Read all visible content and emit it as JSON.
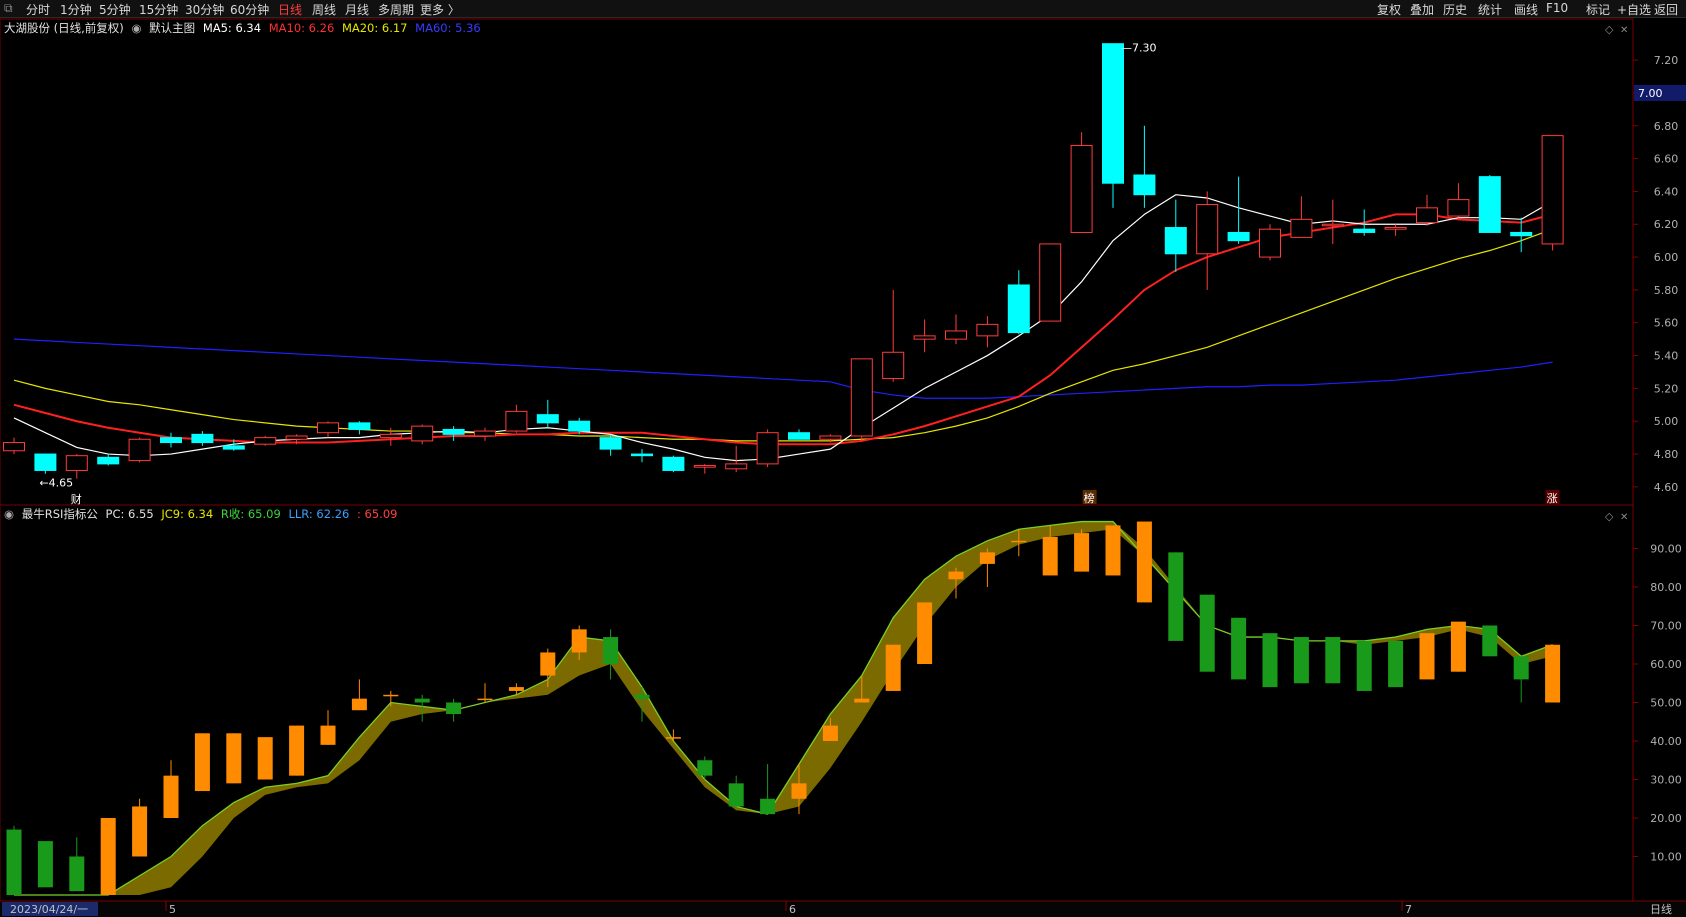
{
  "toolbar": {
    "left_items": [
      "分时",
      "1分钟",
      "5分钟",
      "15分钟",
      "30分钟",
      "60分钟",
      "日线",
      "周线",
      "月线",
      "多周期",
      "更多 〉"
    ],
    "active_index": 6,
    "right_items": [
      "复权",
      "叠加",
      "历史",
      "统计",
      "画线",
      "F10",
      "标记",
      "+自选",
      "返回"
    ]
  },
  "main_header": {
    "stock": "大湖股份 (日线,前复权)",
    "chart_name": "默认主图",
    "ma5": "MA5: 6.34",
    "ma10": "MA10: 6.26",
    "ma20": "MA20: 6.17",
    "ma60": "MA60: 5.36"
  },
  "sub_header": {
    "indicator": "最牛RSI指标公",
    "pc": "PC: 6.55",
    "jc9": "JC9: 6.34",
    "rsi": "R收: 65.09",
    "llr": "LLR: 62.26",
    "extra": ": 65.09"
  },
  "colors": {
    "up": "#ff3b3b",
    "down": "#00ffff",
    "ma5": "#ffffff",
    "ma10": "#ff2020",
    "ma20": "#e6e600",
    "ma60": "#2020ff",
    "rsi_up": "#ff8c00",
    "rsi_down": "#1a9a1a",
    "band": "#7a6a00"
  },
  "main_axis": {
    "min": 4.52,
    "max": 7.42,
    "ticks": [
      "7.20",
      "7.00",
      "6.80",
      "6.60",
      "6.40",
      "6.20",
      "6.00",
      "5.80",
      "5.60",
      "5.40",
      "5.20",
      "5.00",
      "4.80",
      "4.60"
    ],
    "current_price": "7.00"
  },
  "sub_axis": {
    "ticks": [
      "90.00",
      "80.00",
      "70.00",
      "60.00",
      "50.00",
      "40.00",
      "30.00",
      "20.00",
      "10.00"
    ]
  },
  "annotations": {
    "high_label": "7.30",
    "low_label": "4.65",
    "marker_cai": "财",
    "marker_bang": "榜",
    "marker_zhang": "涨"
  },
  "x_axis": {
    "labels": [
      "2023/04/24/一",
      "5",
      "6",
      "7"
    ],
    "period": "日线"
  },
  "chart_data": {
    "type": "candlestick",
    "ohlc": [
      [
        4.82,
        4.9,
        4.8,
        4.87
      ],
      [
        4.8,
        4.8,
        4.68,
        4.7
      ],
      [
        4.7,
        4.8,
        4.65,
        4.79
      ],
      [
        4.78,
        4.8,
        4.73,
        4.74
      ],
      [
        4.76,
        4.9,
        4.75,
        4.89
      ],
      [
        4.9,
        4.93,
        4.84,
        4.87
      ],
      [
        4.92,
        4.94,
        4.85,
        4.87
      ],
      [
        4.85,
        4.89,
        4.82,
        4.83
      ],
      [
        4.86,
        4.91,
        4.85,
        4.9
      ],
      [
        4.89,
        4.92,
        4.86,
        4.91
      ],
      [
        4.93,
        5.0,
        4.9,
        4.99
      ],
      [
        4.99,
        5.0,
        4.92,
        4.95
      ],
      [
        4.9,
        4.96,
        4.85,
        4.92
      ],
      [
        4.88,
        4.98,
        4.86,
        4.97
      ],
      [
        4.95,
        4.97,
        4.88,
        4.92
      ],
      [
        4.91,
        4.96,
        4.88,
        4.94
      ],
      [
        4.94,
        5.1,
        4.93,
        5.06
      ],
      [
        5.04,
        5.13,
        4.96,
        4.99
      ],
      [
        5.0,
        5.02,
        4.92,
        4.94
      ],
      [
        4.9,
        4.92,
        4.79,
        4.83
      ],
      [
        4.8,
        4.83,
        4.75,
        4.79
      ],
      [
        4.78,
        4.79,
        4.69,
        4.7
      ],
      [
        4.72,
        4.74,
        4.68,
        4.73
      ],
      [
        4.71,
        4.85,
        4.69,
        4.74
      ],
      [
        4.74,
        4.95,
        4.72,
        4.93
      ],
      [
        4.93,
        4.95,
        4.9,
        4.89
      ],
      [
        4.89,
        4.92,
        4.87,
        4.91
      ],
      [
        4.91,
        5.38,
        4.88,
        5.38
      ],
      [
        5.26,
        5.8,
        5.24,
        5.42
      ],
      [
        5.5,
        5.62,
        5.42,
        5.52
      ],
      [
        5.5,
        5.65,
        5.47,
        5.55
      ],
      [
        5.52,
        5.64,
        5.45,
        5.59
      ],
      [
        5.83,
        5.92,
        5.53,
        5.54
      ],
      [
        5.61,
        6.08,
        5.61,
        6.08
      ],
      [
        6.15,
        6.76,
        6.15,
        6.68
      ],
      [
        7.3,
        7.3,
        6.3,
        6.45
      ],
      [
        6.5,
        6.8,
        6.3,
        6.38
      ],
      [
        6.18,
        6.35,
        5.91,
        6.02
      ],
      [
        6.02,
        6.4,
        5.8,
        6.32
      ],
      [
        6.15,
        6.49,
        6.08,
        6.1
      ],
      [
        6.0,
        6.2,
        5.98,
        6.17
      ],
      [
        6.12,
        6.37,
        6.12,
        6.23
      ],
      [
        6.2,
        6.35,
        6.08,
        6.2
      ],
      [
        6.17,
        6.29,
        6.13,
        6.15
      ],
      [
        6.17,
        6.2,
        6.13,
        6.18
      ],
      [
        6.21,
        6.38,
        6.19,
        6.3
      ],
      [
        6.25,
        6.45,
        6.24,
        6.35
      ],
      [
        6.49,
        6.5,
        6.15,
        6.15
      ],
      [
        6.15,
        6.24,
        6.03,
        6.13
      ],
      [
        6.08,
        6.74,
        6.04,
        6.74
      ]
    ],
    "ma5": [
      5.02,
      4.93,
      4.84,
      4.8,
      4.79,
      4.8,
      4.83,
      4.86,
      4.88,
      4.89,
      4.9,
      4.9,
      4.92,
      4.93,
      4.94,
      4.93,
      4.95,
      4.96,
      4.94,
      4.92,
      4.87,
      4.83,
      4.78,
      4.76,
      4.77,
      4.8,
      4.83,
      4.96,
      5.08,
      5.2,
      5.3,
      5.4,
      5.52,
      5.65,
      5.85,
      6.1,
      6.26,
      6.38,
      6.36,
      6.3,
      6.25,
      6.2,
      6.22,
      6.2,
      6.2,
      6.2,
      6.24,
      6.24,
      6.23,
      6.34
    ],
    "ma10": [
      5.1,
      5.05,
      5.0,
      4.96,
      4.93,
      4.9,
      4.89,
      4.88,
      4.87,
      4.87,
      4.87,
      4.88,
      4.89,
      4.9,
      4.91,
      4.91,
      4.92,
      4.92,
      4.93,
      4.93,
      4.93,
      4.91,
      4.89,
      4.87,
      4.86,
      4.86,
      4.86,
      4.88,
      4.92,
      4.97,
      5.03,
      5.09,
      5.15,
      5.28,
      5.45,
      5.62,
      5.8,
      5.92,
      6.0,
      6.06,
      6.12,
      6.15,
      6.18,
      6.21,
      6.26,
      6.26,
      6.23,
      6.22,
      6.21,
      6.26
    ],
    "ma20": [
      5.25,
      5.2,
      5.16,
      5.12,
      5.1,
      5.07,
      5.04,
      5.01,
      4.99,
      4.97,
      4.96,
      4.95,
      4.94,
      4.94,
      4.93,
      4.93,
      4.92,
      4.92,
      4.91,
      4.91,
      4.9,
      4.89,
      4.89,
      4.88,
      4.88,
      4.88,
      4.88,
      4.89,
      4.9,
      4.93,
      4.97,
      5.02,
      5.09,
      5.17,
      5.24,
      5.31,
      5.35,
      5.4,
      5.45,
      5.52,
      5.59,
      5.66,
      5.73,
      5.8,
      5.87,
      5.93,
      5.99,
      6.04,
      6.1,
      6.17
    ],
    "ma60": [
      5.5,
      5.49,
      5.48,
      5.47,
      5.46,
      5.45,
      5.44,
      5.43,
      5.42,
      5.41,
      5.4,
      5.39,
      5.38,
      5.37,
      5.36,
      5.35,
      5.34,
      5.33,
      5.32,
      5.31,
      5.3,
      5.29,
      5.28,
      5.27,
      5.26,
      5.25,
      5.24,
      5.19,
      5.16,
      5.14,
      5.14,
      5.14,
      5.15,
      5.16,
      5.17,
      5.18,
      5.19,
      5.2,
      5.21,
      5.21,
      5.22,
      5.22,
      5.23,
      5.24,
      5.25,
      5.27,
      5.29,
      5.31,
      5.33,
      5.36
    ],
    "rsi_ohlc": [
      [
        17,
        18,
        0,
        0
      ],
      [
        14,
        14,
        2,
        2
      ],
      [
        10,
        15,
        1,
        1
      ],
      [
        0,
        20,
        0,
        20
      ],
      [
        10,
        25,
        10,
        23
      ],
      [
        20,
        35,
        20,
        31
      ],
      [
        27,
        42,
        27,
        42
      ],
      [
        29,
        42,
        29,
        42
      ],
      [
        30,
        41,
        30,
        41
      ],
      [
        31,
        44,
        31,
        44
      ],
      [
        39,
        48,
        39,
        44
      ],
      [
        48,
        56,
        48,
        51
      ],
      [
        52,
        53,
        49,
        52
      ],
      [
        51,
        52,
        45,
        50
      ],
      [
        50,
        51,
        45,
        47
      ],
      [
        51,
        55,
        50,
        51
      ],
      [
        53,
        55,
        52,
        54
      ],
      [
        57,
        64,
        54,
        63
      ],
      [
        63,
        70,
        61,
        69
      ],
      [
        67,
        69,
        56,
        60
      ],
      [
        52,
        54,
        45,
        51
      ],
      [
        41,
        43,
        40,
        41
      ],
      [
        35,
        36,
        30,
        31
      ],
      [
        29,
        31,
        22,
        23
      ],
      [
        25,
        34,
        21,
        21
      ],
      [
        25,
        34,
        21,
        29
      ],
      [
        40,
        46,
        40,
        44
      ],
      [
        50,
        57,
        50,
        51
      ],
      [
        53,
        65,
        53,
        65
      ],
      [
        60,
        72,
        60,
        76
      ],
      [
        82,
        85,
        77,
        84
      ],
      [
        86,
        90,
        80,
        89
      ],
      [
        92,
        95,
        88,
        92
      ],
      [
        83,
        96,
        83,
        93
      ],
      [
        84,
        95,
        84,
        94
      ],
      [
        83,
        96,
        83,
        96
      ],
      [
        76,
        97,
        76,
        97
      ],
      [
        89,
        89,
        66,
        66
      ],
      [
        78,
        78,
        58,
        58
      ],
      [
        72,
        72,
        56,
        56
      ],
      [
        68,
        68,
        54,
        54
      ],
      [
        67,
        67,
        55,
        55
      ],
      [
        67,
        67,
        55,
        55
      ],
      [
        66,
        66,
        53,
        53
      ],
      [
        66,
        66,
        54,
        54
      ],
      [
        56,
        68,
        56,
        68
      ],
      [
        58,
        71,
        58,
        71
      ],
      [
        70,
        70,
        62,
        62
      ],
      [
        62,
        62,
        50,
        56
      ],
      [
        50,
        65,
        50,
        65
      ]
    ],
    "rsi_line": [
      0,
      0,
      0,
      0,
      5,
      10,
      18,
      24,
      28,
      29,
      31,
      41,
      50,
      49,
      48,
      50,
      52,
      56,
      67,
      66,
      54,
      40,
      30,
      23,
      21,
      34,
      47,
      57,
      72,
      82,
      88,
      92,
      95,
      96,
      97,
      97,
      88,
      79,
      70,
      67,
      67,
      66,
      66,
      66,
      67,
      69,
      70,
      69,
      62,
      65
    ],
    "rsi_jc": [
      0,
      0,
      0,
      0,
      0,
      2,
      10,
      20,
      26,
      28,
      29,
      35,
      45,
      47,
      48,
      50,
      51,
      52,
      57,
      60,
      48,
      38,
      28,
      22,
      21,
      23,
      33,
      45,
      58,
      70,
      80,
      87,
      91,
      93,
      94,
      95,
      90,
      80,
      70,
      67,
      67,
      66,
      66,
      65,
      66,
      67,
      69,
      67,
      60,
      62
    ]
  }
}
